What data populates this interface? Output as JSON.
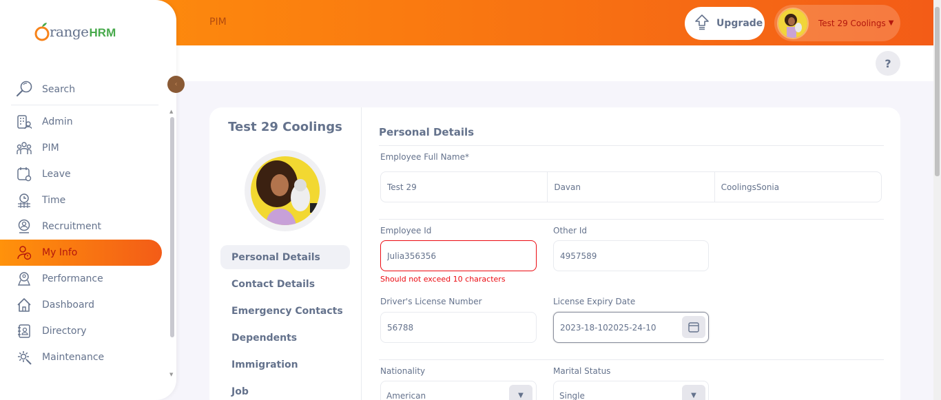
{
  "topbar": {
    "title": "PIM",
    "upgrade_label": "Upgrade",
    "user_name": "Test 29 Coolings"
  },
  "sidebar": {
    "logo_text": "range",
    "logo_hrm": "HRM",
    "search_label": "Search",
    "items": [
      {
        "label": "Admin",
        "icon": "admin-icon"
      },
      {
        "label": "PIM",
        "icon": "pim-icon"
      },
      {
        "label": "Leave",
        "icon": "leave-icon"
      },
      {
        "label": "Time",
        "icon": "time-icon"
      },
      {
        "label": "Recruitment",
        "icon": "recruitment-icon"
      },
      {
        "label": "My Info",
        "icon": "myinfo-icon",
        "active": true
      },
      {
        "label": "Performance",
        "icon": "performance-icon"
      },
      {
        "label": "Dashboard",
        "icon": "dashboard-icon"
      },
      {
        "label": "Directory",
        "icon": "directory-icon"
      },
      {
        "label": "Maintenance",
        "icon": "maintenance-icon"
      }
    ]
  },
  "help_label": "?",
  "employee": {
    "name": "Test 29 Coolings"
  },
  "tabs": [
    {
      "label": "Personal Details",
      "active": true
    },
    {
      "label": "Contact Details"
    },
    {
      "label": "Emergency Contacts"
    },
    {
      "label": "Dependents"
    },
    {
      "label": "Immigration"
    },
    {
      "label": "Job"
    }
  ],
  "form": {
    "title": "Personal Details",
    "full_name_label": "Employee Full Name*",
    "first_name": "Test 29",
    "middle_name": "Davan",
    "last_name": "CoolingsSonia",
    "employee_id_label": "Employee Id",
    "employee_id": "Julia356356",
    "employee_id_error": "Should not exceed 10 characters",
    "other_id_label": "Other Id",
    "other_id": "4957589",
    "license_label": "Driver's License Number",
    "license": "56788",
    "expiry_label": "License Expiry Date",
    "expiry": "2023-18-102025-24-10",
    "nationality_label": "Nationality",
    "nationality": "American",
    "marital_label": "Marital Status",
    "marital": "Single"
  },
  "colors": {
    "brand_orange": "#ff7b1d",
    "text": "#64728c",
    "error": "#eb0910",
    "hrm_green": "#47a94b"
  }
}
